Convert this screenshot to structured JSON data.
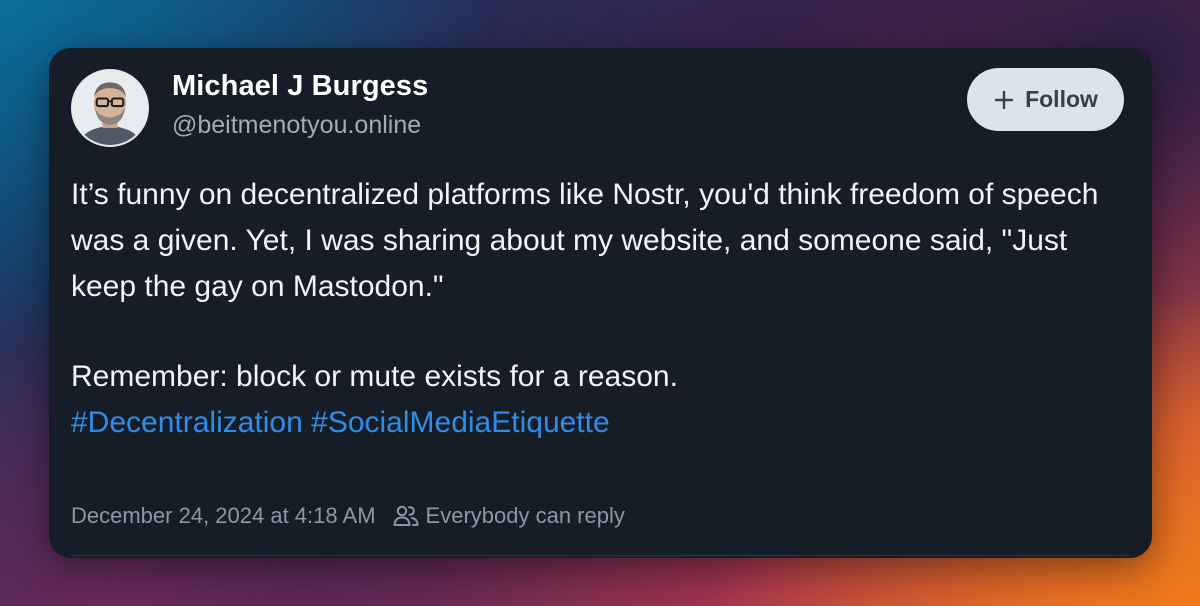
{
  "post": {
    "author_name": "Michael J Burgess",
    "author_handle": "@beitmenotyou.online",
    "follow_label": "Follow",
    "paragraphs": [
      "It’s funny on decentralized platforms like Nostr, you'd think freedom of speech was a given. Yet, I was sharing about my website, and someone said, \"Just keep the gay on Mastodon.\"",
      "Remember: block or mute exists for a reason."
    ],
    "hashtags": [
      "#Decentralization",
      "#SocialMediaEtiquette"
    ],
    "timestamp": "December 24, 2024 at 4:18 AM",
    "reply_setting": "Everybody can reply"
  },
  "icons": {
    "follow": "plus-icon",
    "reply_setting": "people-icon"
  },
  "colors": {
    "card_bg": "#161d26",
    "hashtag": "#2f8ce8",
    "follow_button_bg": "#dde3ea",
    "muted_text": "#8d97a3"
  }
}
